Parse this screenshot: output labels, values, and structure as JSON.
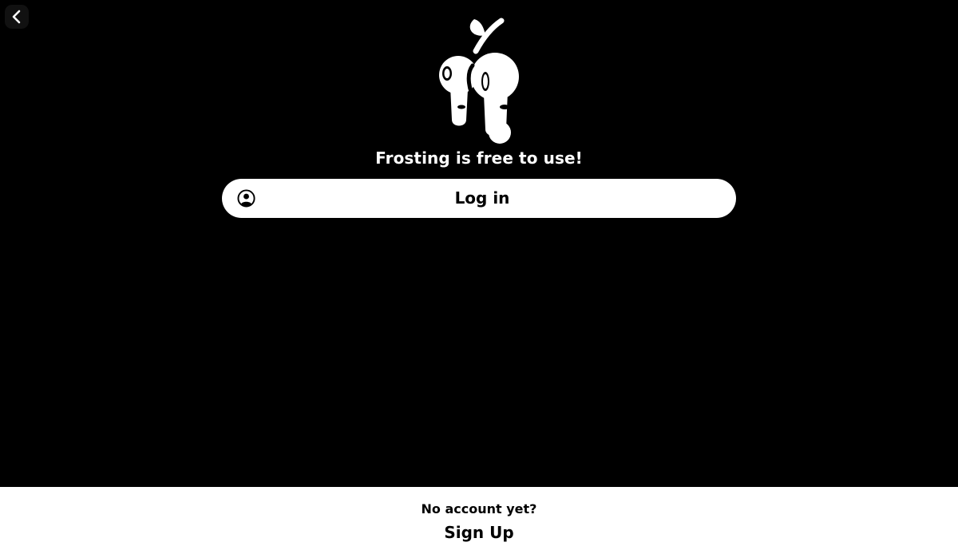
{
  "nav": {
    "back_icon": "chevron-left-icon"
  },
  "brand": {
    "logo_icon": "dripping-cherries-logo"
  },
  "main": {
    "tagline": "Frosting is free to use!",
    "login_label": "Log in",
    "login_icon": "user-circle-icon"
  },
  "footer": {
    "prompt": "No account yet?",
    "signup_label": "Sign Up"
  },
  "colors": {
    "background": "#000000",
    "surface": "#ffffff",
    "text_on_dark": "#ffffff",
    "text_on_light": "#000000"
  }
}
